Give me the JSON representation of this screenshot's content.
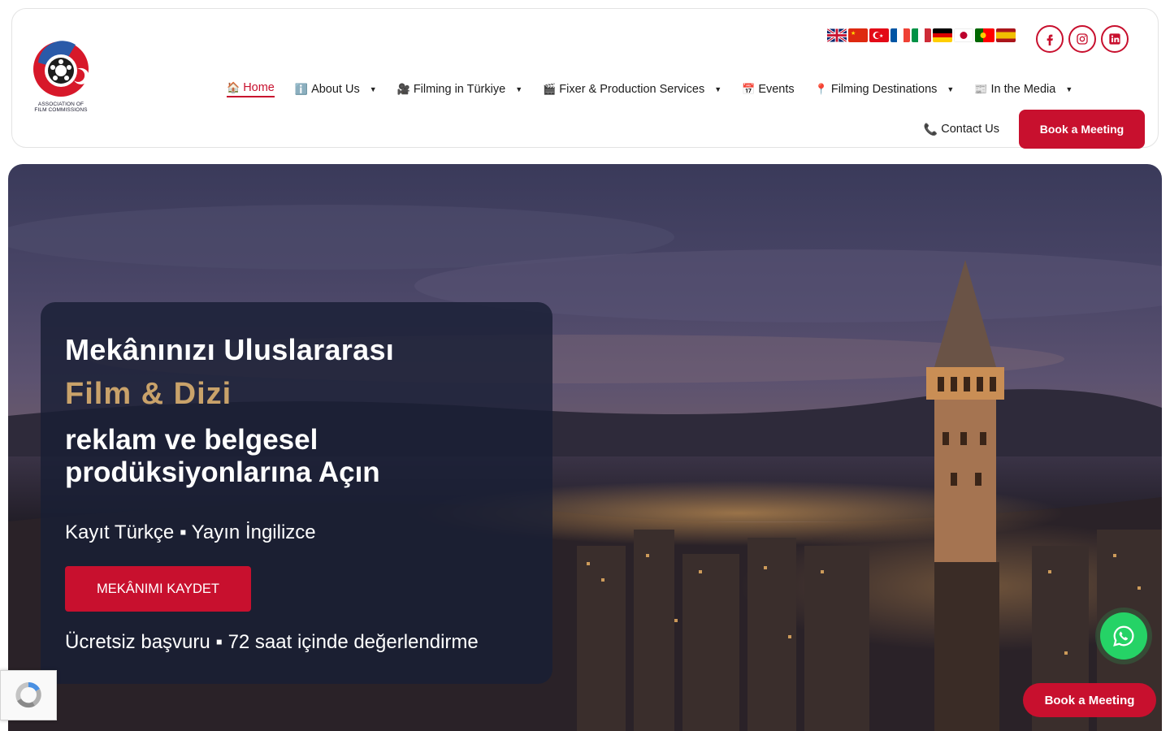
{
  "logo": {
    "text_line1": "ASSOCIATION OF",
    "text_line2": "FILM COMMISSIONS"
  },
  "languages": [
    "English",
    "Chinese",
    "Turkish",
    "French",
    "Italian",
    "German",
    "Japanese",
    "Portuguese",
    "Spanish"
  ],
  "socials": [
    "facebook-icon",
    "instagram-icon",
    "linkedin-icon"
  ],
  "nav": {
    "home": "Home",
    "about": "About Us",
    "filming": "Filming in Türkiye",
    "fixer": "Fixer & Production Services",
    "events": "Events",
    "destinations": "Filming Destinations",
    "media": "In the Media",
    "contact": "Contact Us",
    "book": "Book a Meeting"
  },
  "hero": {
    "line1": "Mekânınızı Uluslararası",
    "line2": "Film & Dizi",
    "line3": "reklam ve belgesel prodüksiyonlarına Açın",
    "sub1": "Kayıt Türkçe ▪ Yayın İngilizce",
    "cta": "MEKÂNIMI KAYDET",
    "sub2": "Ücretsiz başvuru ▪ 72 saat içinde değerlendirme"
  },
  "floating": {
    "book": "Book a Meeting"
  },
  "colors": {
    "brand_red": "#c8102e",
    "gold": "#c9a26a",
    "whatsapp": "#25d366"
  }
}
